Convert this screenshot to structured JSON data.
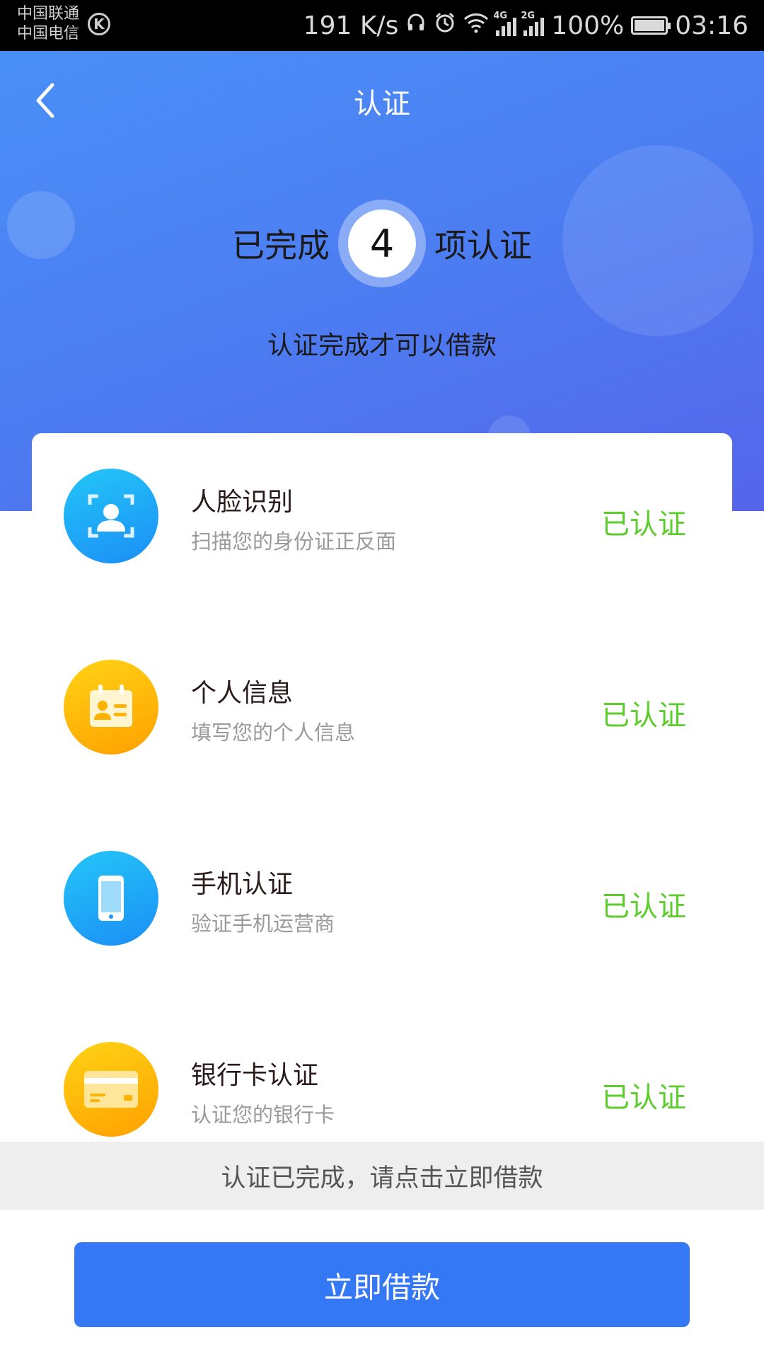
{
  "status_bar": {
    "carrier_1": "中国联通",
    "carrier_2": "中国电信",
    "k_icon": "K",
    "net_speed": "191 K/s",
    "net_4g": "4G",
    "net_2g": "2G",
    "battery": "100%",
    "time": "03:16"
  },
  "header": {
    "title": "认证",
    "back_icon": "chevron-left-icon",
    "completed_prefix": "已完成",
    "completed_count": "4",
    "completed_suffix": "项认证",
    "subtitle": "认证完成才可以借款"
  },
  "items": [
    {
      "title": "人脸识别",
      "desc": "扫描您的身份证正反面",
      "status": "已认证",
      "icon": "face-scan-icon",
      "color": "#1b9af6"
    },
    {
      "title": "个人信息",
      "desc": "填写您的个人信息",
      "status": "已认证",
      "icon": "id-card-icon",
      "color": "#ffb300"
    },
    {
      "title": "手机认证",
      "desc": "验证手机运营商",
      "status": "已认证",
      "icon": "phone-icon",
      "color": "#1b9af6"
    },
    {
      "title": "银行卡认证",
      "desc": "认证您的银行卡",
      "status": "已认证",
      "icon": "bank-card-icon",
      "color": "#ffb300"
    }
  ],
  "notice": "认证已完成，请点击立即借款",
  "cta_label": "立即借款",
  "colors": {
    "primary": "#3478f6",
    "verified": "#5ccd2c",
    "header_bg": "#4c7df2"
  }
}
